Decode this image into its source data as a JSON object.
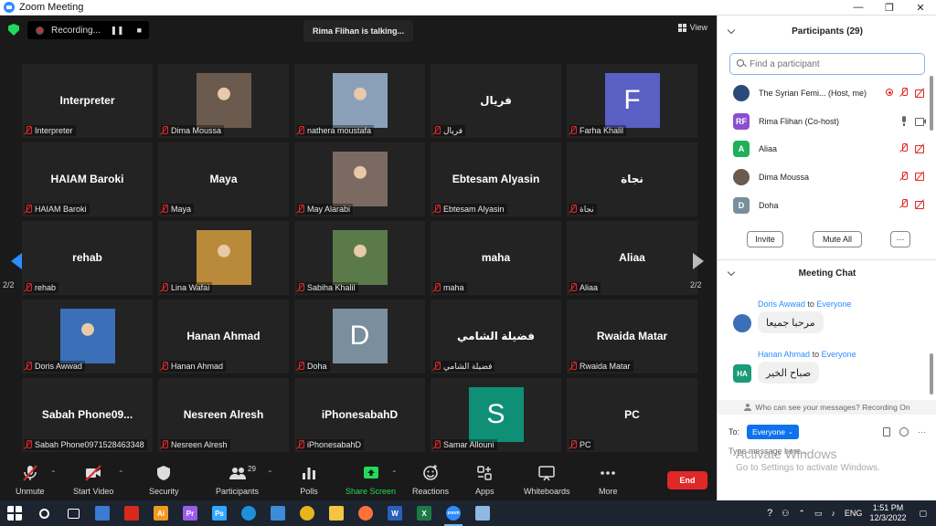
{
  "window": {
    "title": "Zoom Meeting"
  },
  "top": {
    "recording_label": "Recording...",
    "talking": "Rima Flihan is talking...",
    "view_label": "View"
  },
  "gallery": {
    "page_indicator": "2/2",
    "tiles": [
      {
        "name": "Interpreter",
        "center": "Interpreter"
      },
      {
        "name": "Dima Moussa",
        "photo": true,
        "photo_color": "#6b5a4e"
      },
      {
        "name": "nathera moustafa",
        "photo": true,
        "photo_color": "#8aa0b8"
      },
      {
        "name": "فريال",
        "center": "فريال"
      },
      {
        "name": "Farha Khalil",
        "avatar": "F",
        "avatar_color": "#5a5fc4"
      },
      {
        "name": "HAIAM Baroki",
        "center": "HAIAM Baroki"
      },
      {
        "name": "Maya",
        "center": "Maya"
      },
      {
        "name": "May Alarabi",
        "photo": true,
        "photo_color": "#7a6a62"
      },
      {
        "name": "Ebtesam Alyasin",
        "center": "Ebtesam Alyasin"
      },
      {
        "name": "نجاة",
        "center": "نجاة"
      },
      {
        "name": "rehab",
        "center": "rehab"
      },
      {
        "name": "Lina Wafai",
        "photo": true,
        "photo_color": "#b88a3a"
      },
      {
        "name": "Sabiha Khalil",
        "photo": true,
        "photo_color": "#5b7a4a"
      },
      {
        "name": "maha",
        "center": "maha"
      },
      {
        "name": "Aliaa",
        "center": "Aliaa"
      },
      {
        "name": "Doris Awwad",
        "photo": true,
        "photo_color": "#3b6fb8"
      },
      {
        "name": "Hanan Ahmad",
        "center": "Hanan Ahmad"
      },
      {
        "name": "Doha",
        "avatar": "D",
        "avatar_color": "#7a8f9e"
      },
      {
        "name": "فضيلة الشامي",
        "center": "فضيلة الشامي"
      },
      {
        "name": "Rwaida Matar",
        "center": "Rwaida Matar"
      },
      {
        "name": "Sabah Phone0971528463348",
        "center": "Sabah Phone09..."
      },
      {
        "name": "Nesreen Alresh",
        "center": "Nesreen Alresh"
      },
      {
        "name": "iPhonesabahD",
        "center": "iPhonesabahD"
      },
      {
        "name": "Samar Allouni",
        "avatar": "S",
        "avatar_color": "#0e8f76"
      },
      {
        "name": "PC",
        "center": "PC"
      }
    ]
  },
  "toolbar": {
    "unmute": "Unmute",
    "start_video": "Start Video",
    "security": "Security",
    "participants": "Participants",
    "participants_count": "29",
    "polls": "Polls",
    "share_screen": "Share Screen",
    "reactions": "Reactions",
    "apps": "Apps",
    "whiteboards": "Whiteboards",
    "more": "More",
    "end": "End"
  },
  "participants_panel": {
    "title": "Participants (29)",
    "search_placeholder": "Find a participant",
    "rows": [
      {
        "name": "The Syrian Femi... (Host, me)",
        "initials": "",
        "color": "#2a4a7a",
        "recording": true,
        "mic": "off",
        "cam": "off"
      },
      {
        "name": "Rima Flihan (Co-host)",
        "initials": "RF",
        "color": "#8a4fd0",
        "recording": false,
        "mic": "on",
        "cam": "on"
      },
      {
        "name": "Aliaa",
        "initials": "A",
        "color": "#1fb05a",
        "recording": false,
        "mic": "off",
        "cam": "off"
      },
      {
        "name": "Dima Moussa",
        "initials": "",
        "color": "#6b5a4e",
        "recording": false,
        "mic": "off",
        "cam": "off"
      },
      {
        "name": "Doha",
        "initials": "D",
        "color": "#7a8f9e",
        "recording": false,
        "mic": "off",
        "cam": "off"
      }
    ],
    "invite": "Invite",
    "mute_all": "Mute All",
    "more": "···"
  },
  "chat": {
    "title": "Meeting Chat",
    "to_word": "to",
    "messages": [
      {
        "from": "Doris Awwad",
        "to": "Everyone",
        "text": "مرحبا جميعا",
        "initials": "",
        "color": "#3b6fb8"
      },
      {
        "from": "Hanan Ahmad",
        "to": "Everyone",
        "text": "صباح الخير",
        "initials": "HA",
        "color": "#1a9b7a"
      }
    ],
    "notice": "Who can see your messages? Recording On",
    "to_label": "To:",
    "recipient": "Everyone",
    "input_placeholder": "Type message here..."
  },
  "watermark": {
    "line1": "Activate Windows",
    "line2": "Go to Settings to activate Windows."
  },
  "taskbar": {
    "apps": [
      {
        "name": "start-icon",
        "color": "#ffffff",
        "label": ""
      },
      {
        "name": "search-icon",
        "color": "#1c2430",
        "label": ""
      },
      {
        "name": "task-view-icon",
        "color": "#1c2430",
        "label": ""
      },
      {
        "name": "store-icon",
        "color": "#3a7bd5",
        "label": ""
      },
      {
        "name": "acrobat-icon",
        "color": "#d62a1e",
        "label": ""
      },
      {
        "name": "illustrator-icon",
        "color": "#f29a1f",
        "label": "Ai"
      },
      {
        "name": "premiere-icon",
        "color": "#9a5de8",
        "label": "Pr"
      },
      {
        "name": "photoshop-icon",
        "color": "#31a8ff",
        "label": "Ps"
      },
      {
        "name": "edge-icon",
        "color": "#1f8fd8",
        "label": ""
      },
      {
        "name": "mail-icon",
        "color": "#3d8bdb",
        "label": ""
      },
      {
        "name": "chrome-icon",
        "color": "#e8b41c",
        "label": ""
      },
      {
        "name": "explorer-icon",
        "color": "#f4c542",
        "label": ""
      },
      {
        "name": "firefox-icon",
        "color": "#ff7139",
        "label": ""
      },
      {
        "name": "word-icon",
        "color": "#2b5fb8",
        "label": "W"
      },
      {
        "name": "excel-icon",
        "color": "#1e7a45",
        "label": "X"
      },
      {
        "name": "zoom-icon",
        "color": "#2d8cff",
        "label": "zoom"
      },
      {
        "name": "paint-icon",
        "color": "#8fb8e0",
        "label": ""
      }
    ],
    "lang": "ENG",
    "time": "1:51 PM",
    "date": "12/3/2022"
  }
}
